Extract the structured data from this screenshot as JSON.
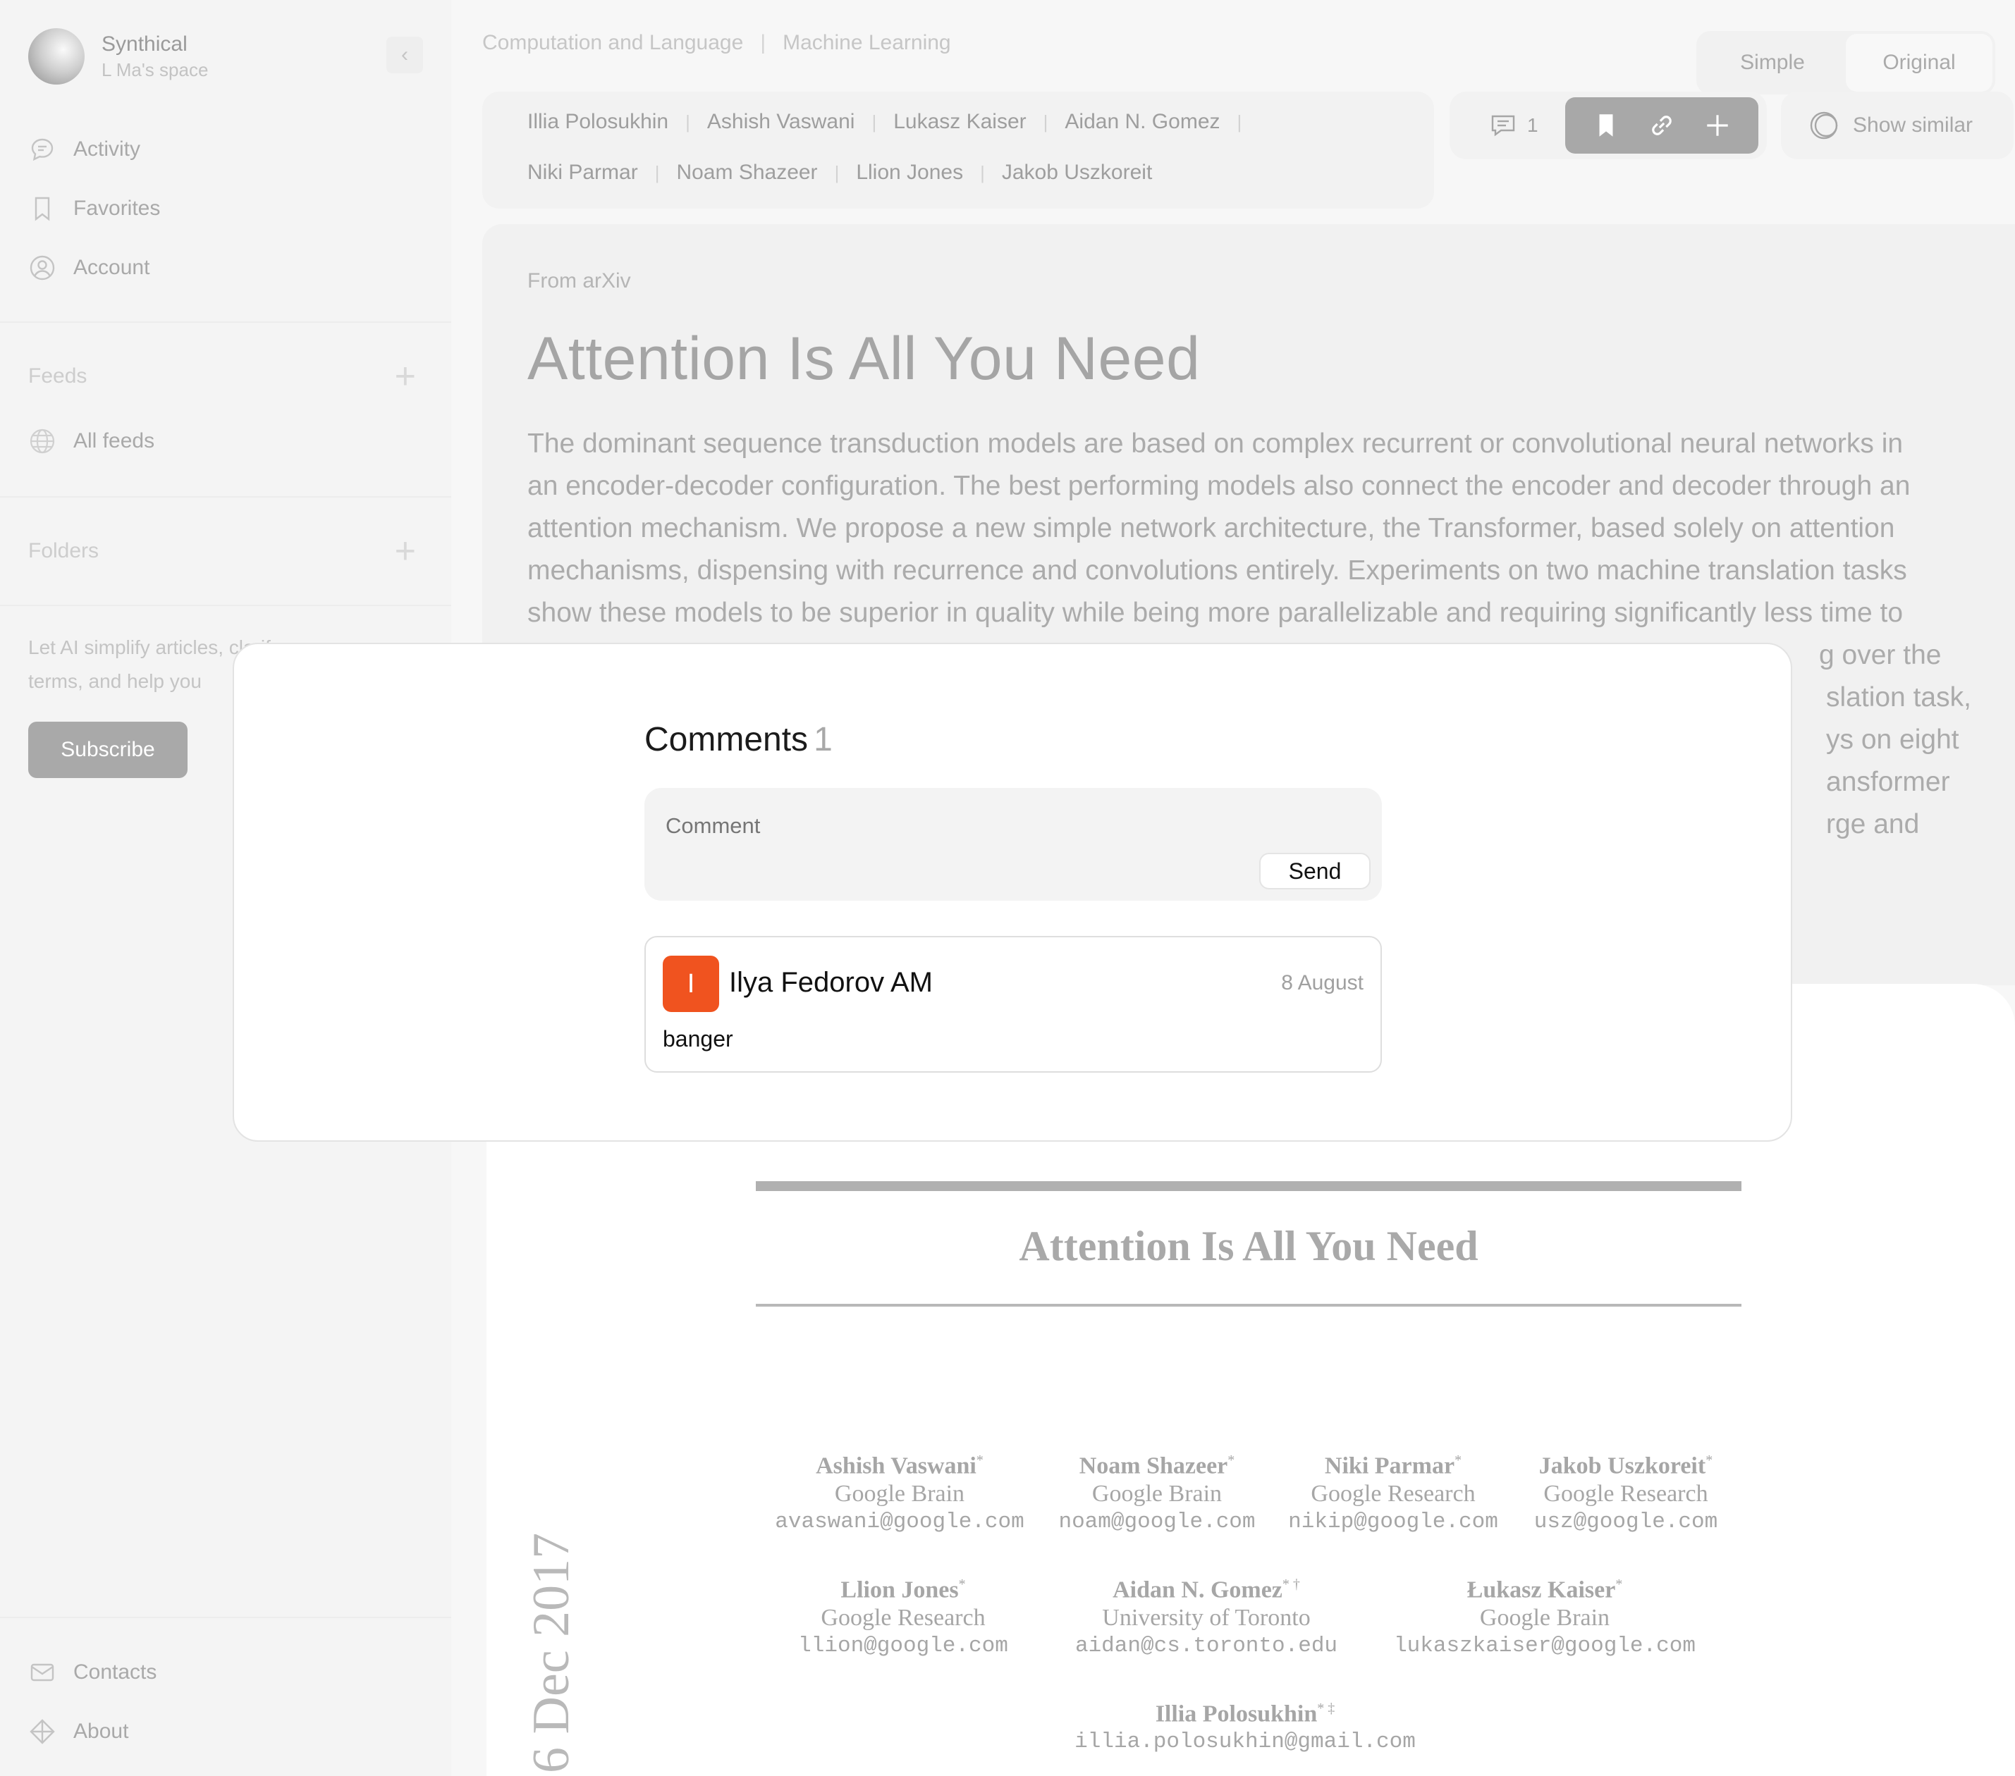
{
  "sidebar": {
    "space_name": "Synthical",
    "space_sub": "L Ma's space",
    "nav": [
      {
        "label": "Activity",
        "icon": "chat-bubble-icon"
      },
      {
        "label": "Favorites",
        "icon": "bookmark-icon"
      },
      {
        "label": "Account",
        "icon": "user-circle-icon"
      }
    ],
    "feeds_label": "Feeds",
    "all_feeds_label": "All feeds",
    "folders_label": "Folders",
    "promo_text": "Let AI simplify articles, clarif",
    "promo_text_2": "terms, and help you",
    "subscribe_label": "Subscribe",
    "footer_nav": [
      {
        "label": "Contacts",
        "icon": "mail-icon"
      },
      {
        "label": "About",
        "icon": "diamond-icon"
      }
    ]
  },
  "breadcrumb": [
    "Computation and Language",
    "Machine Learning"
  ],
  "view_toggle": {
    "simple": "Simple",
    "original": "Original"
  },
  "authors": [
    "Illia Polosukhin",
    "Ashish Vaswani",
    "Lukasz Kaiser",
    "Aidan N. Gomez",
    "Niki Parmar",
    "Noam Shazeer",
    "Llion Jones",
    "Jakob Uszkoreit"
  ],
  "actions": {
    "comment_count": "1",
    "show_similar": "Show similar"
  },
  "article": {
    "source": "From arXiv",
    "title": "Attention Is All You Need",
    "abstract_lines": [
      "The dominant sequence transduction models are based on complex recurrent or convolutional neural networks in",
      "an encoder-decoder configuration. The best performing models also connect the encoder and decoder through an",
      "attention mechanism. We propose a new simple network architecture, the Transformer, based solely on attention",
      "mechanisms, dispensing with recurrence and convolutions entirely. Experiments on two machine translation tasks",
      "show these models to be superior in quality while being more parallelizable and requiring significantly less time to",
      "g over the",
      "slation task,",
      "ys on eight",
      "ansformer",
      "rge and"
    ]
  },
  "paper": {
    "title": "Attention Is All You Need",
    "side_date": "6 Dec 2017",
    "authors": [
      {
        "name": "Ashish Vaswani",
        "mark": "*",
        "org": "Google Brain",
        "email": "avaswani@google.com"
      },
      {
        "name": "Noam Shazeer",
        "mark": "*",
        "org": "Google Brain",
        "email": "noam@google.com"
      },
      {
        "name": "Niki Parmar",
        "mark": "*",
        "org": "Google Research",
        "email": "nikip@google.com"
      },
      {
        "name": "Jakob Uszkoreit",
        "mark": "*",
        "org": "Google Research",
        "email": "usz@google.com"
      },
      {
        "name": "Llion Jones",
        "mark": "*",
        "org": "Google Research",
        "email": "llion@google.com"
      },
      {
        "name": "Aidan N. Gomez",
        "mark": "* †",
        "org": "University of Toronto",
        "email": "aidan@cs.toronto.edu"
      },
      {
        "name": "Łukasz Kaiser",
        "mark": "*",
        "org": "Google Brain",
        "email": "lukaszkaiser@google.com"
      },
      {
        "name": "Illia Polosukhin",
        "mark": "* ‡",
        "org": "",
        "email": "illia.polosukhin@gmail.com"
      }
    ]
  },
  "modal": {
    "title": "Comments",
    "count": "1",
    "input_placeholder": "Comment",
    "send_label": "Send",
    "comments": [
      {
        "avatar_letter": "I",
        "author": "Ilya Fedorov AM",
        "date": "8 August",
        "text": "banger",
        "avatar_color": "#f0531f"
      }
    ]
  }
}
